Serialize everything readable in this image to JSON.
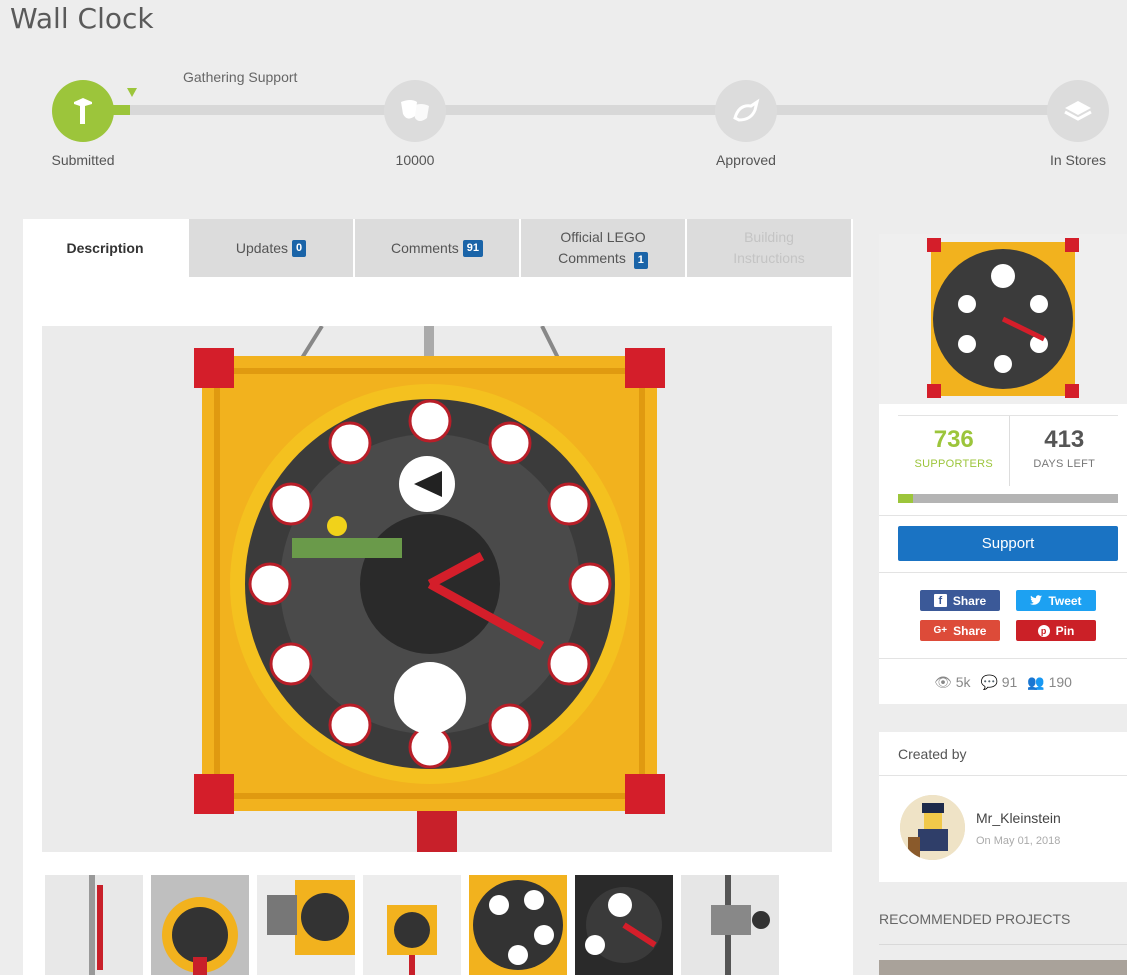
{
  "page": {
    "title": "Wall Clock"
  },
  "track": {
    "phase_label": "Gathering Support",
    "progress_pct": 4.8,
    "stages": [
      {
        "label": "Submitted",
        "icon": "submitted-icon",
        "active": true
      },
      {
        "label": "10000",
        "icon": "theater-masks-icon",
        "active": false
      },
      {
        "label": "Approved",
        "icon": "approved-icon",
        "active": false
      },
      {
        "label": "In Stores",
        "icon": "store-box-icon",
        "active": false
      }
    ]
  },
  "tabs": [
    {
      "label": "Description",
      "active": true
    },
    {
      "label": "Updates",
      "badge": "0"
    },
    {
      "label": "Comments",
      "badge": "91"
    },
    {
      "label_line1": "Official LEGO",
      "label_line2": "Comments",
      "badge": "1"
    },
    {
      "label_line1": "Building",
      "label_line2": "Instructions",
      "disabled": true
    }
  ],
  "stats": {
    "supporters": "736",
    "supporters_label": "SUPPORTERS",
    "days_left": "413",
    "days_left_label": "DAYS LEFT",
    "support_progress_pct": 7
  },
  "support_button": "Support",
  "share": {
    "facebook": "Share",
    "twitter": "Tweet",
    "google": "Share",
    "google_prefix": "G+",
    "pinterest": "Pin"
  },
  "meta": {
    "views": "5k",
    "comments": "91",
    "followers": "190"
  },
  "creator": {
    "heading": "Created by",
    "name": "Mr_Kleinstein",
    "date": "On May 01, 2018"
  },
  "recommended_heading": "RECOMMENDED PROJECTS",
  "colors": {
    "accent_green": "#9cc53b",
    "badge_blue": "#1a64a8",
    "support_blue": "#1a73c3",
    "facebook": "#3b5998",
    "twitter": "#1da1f2",
    "google": "#dd4b39",
    "pinterest": "#cb2027"
  }
}
